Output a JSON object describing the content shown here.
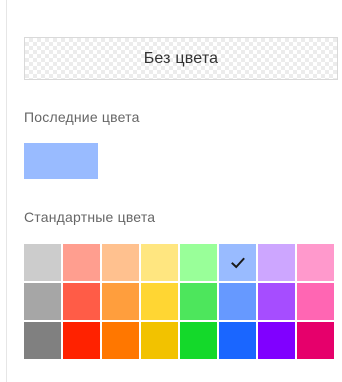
{
  "no_color": {
    "label": "Без цвета"
  },
  "recent": {
    "label": "Последние цвета",
    "colors": [
      "#99bbff"
    ]
  },
  "standard": {
    "label": "Стандартные цвета",
    "selected": "#99bbff",
    "rows": [
      [
        "#cccccc",
        "#ff9e8f",
        "#ffc18f",
        "#ffe680",
        "#99ff99",
        "#99bbff",
        "#cda6ff",
        "#ff99cc"
      ],
      [
        "#a6a6a6",
        "#ff5c47",
        "#ff9e3d",
        "#ffd633",
        "#4de65c",
        "#6699ff",
        "#a64dff",
        "#ff66b3"
      ],
      [
        "#808080",
        "#ff2200",
        "#ff7700",
        "#f2c200",
        "#14d92a",
        "#1a66ff",
        "#8000ff",
        "#e6006b"
      ]
    ],
    "check_icon": "checkmark-icon"
  }
}
